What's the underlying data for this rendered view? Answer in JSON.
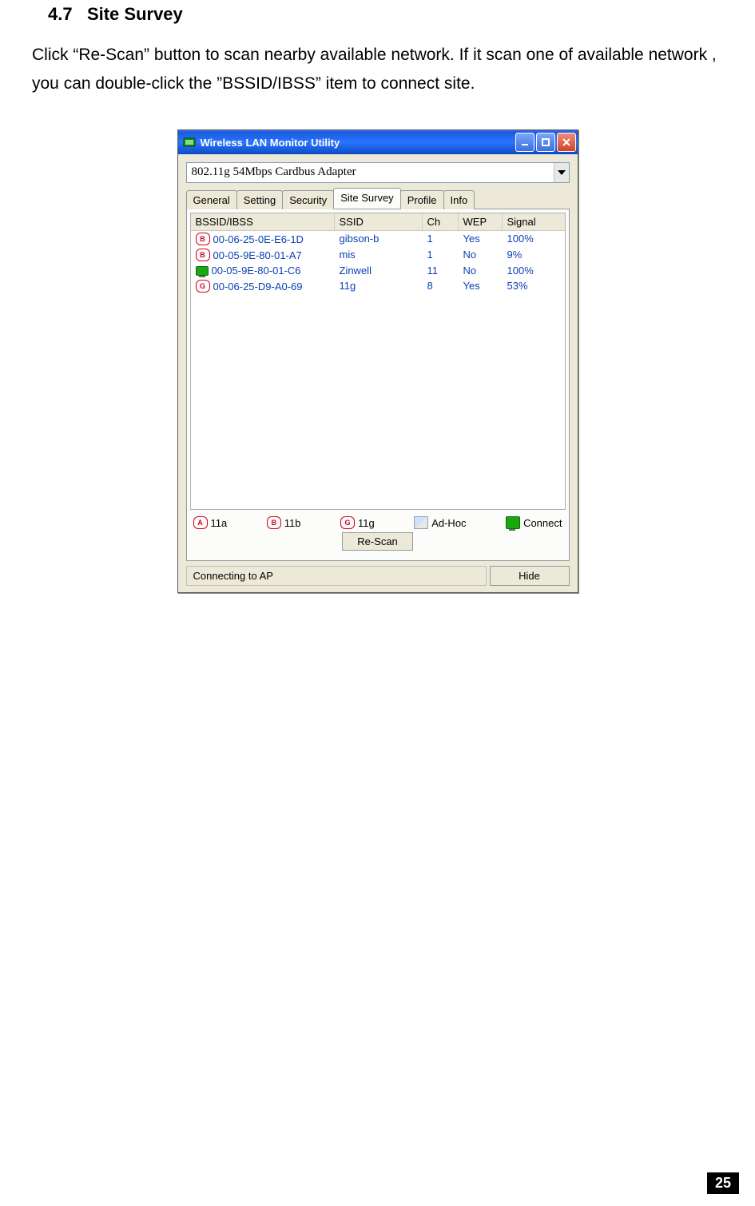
{
  "section_number": "4.7",
  "section_title": "Site Survey",
  "body_text": "Click “Re-Scan” button to scan nearby available network. If it scan one of available network , you can double-click the ”BSSID/IBSS” item to connect site.",
  "window": {
    "title": "Wireless LAN Monitor Utility",
    "adapter": "802.11g 54Mbps Cardbus Adapter",
    "tabs": [
      "General",
      "Setting",
      "Security",
      "Site Survey",
      "Profile",
      "Info"
    ],
    "active_tab": "Site Survey",
    "columns": {
      "bssid": "BSSID/IBSS",
      "ssid": "SSID",
      "ch": "Ch",
      "wep": "WEP",
      "signal": "Signal"
    },
    "rows": [
      {
        "icon": "B",
        "icon_style": "red",
        "bssid": "00-06-25-0E-E6-1D",
        "ssid": "gibson-b",
        "ch": "1",
        "wep": "Yes",
        "signal": "100%"
      },
      {
        "icon": "B",
        "icon_style": "red",
        "bssid": "00-05-9E-80-01-A7",
        "ssid": "mis",
        "ch": "1",
        "wep": "No",
        "signal": "9%"
      },
      {
        "icon": "",
        "icon_style": "green",
        "bssid": "00-05-9E-80-01-C6",
        "ssid": "Zinwell",
        "ch": "11",
        "wep": "No",
        "signal": "100%"
      },
      {
        "icon": "G",
        "icon_style": "red",
        "bssid": "00-06-25-D9-A0-69",
        "ssid": "11g",
        "ch": "8",
        "wep": "Yes",
        "signal": "53%"
      }
    ],
    "legend": {
      "a": "11a",
      "a_icon": "A",
      "b": "11b",
      "b_icon": "B",
      "g": "11g",
      "g_icon": "G",
      "adhoc": "Ad-Hoc",
      "connect": "Connect"
    },
    "rescan": "Re-Scan",
    "status": "Connecting to AP",
    "hide": "Hide"
  },
  "page_number": "25"
}
